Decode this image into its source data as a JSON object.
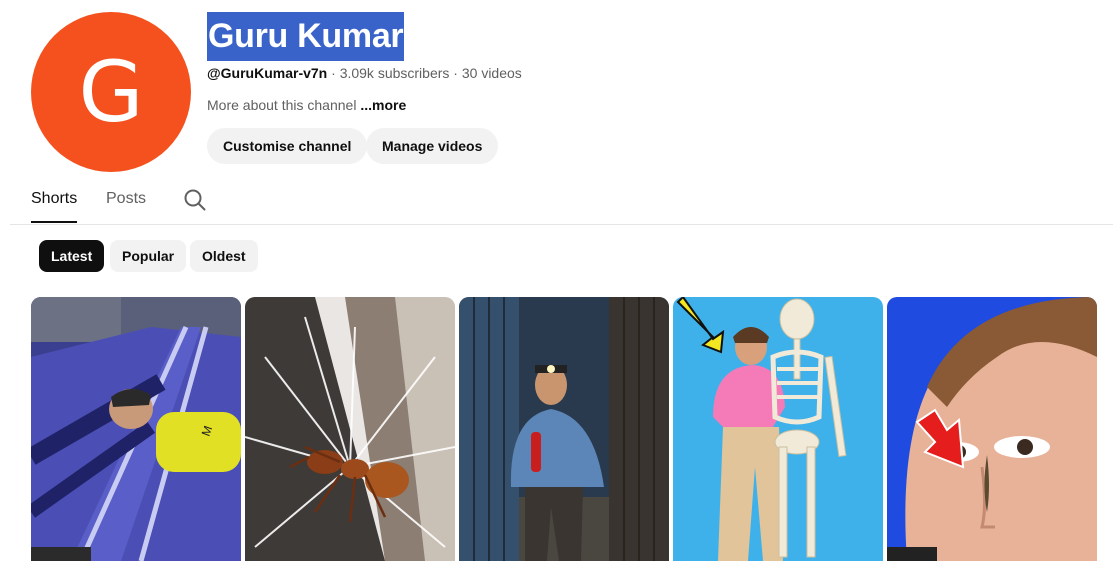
{
  "channel": {
    "avatar_letter": "G",
    "avatar_color": "#f4511e",
    "name": "Guru Kumar",
    "handle": "@GuruKumar-v7n",
    "separator": "·",
    "subscribers": "3.09k subscribers",
    "videos": "30 videos",
    "about_text": "More about this channel",
    "about_more": "...more"
  },
  "actions": {
    "customise_label": "Customise channel",
    "manage_label": "Manage videos"
  },
  "tabs": [
    {
      "label": "Shorts",
      "selected": true
    },
    {
      "label": "Posts",
      "selected": false
    }
  ],
  "search_icon": "search-icon",
  "filters": [
    {
      "label": "Latest",
      "selected": true
    },
    {
      "label": "Popular",
      "selected": false
    },
    {
      "label": "Oldest",
      "selected": false
    }
  ],
  "shorts": [
    {
      "thumbnail": "man-on-railway-tracks"
    },
    {
      "thumbnail": "ant-closeup"
    },
    {
      "thumbnail": "man-with-fire-extinguisher"
    },
    {
      "thumbnail": "man-and-skeleton"
    },
    {
      "thumbnail": "face-with-red-arrow"
    }
  ]
}
